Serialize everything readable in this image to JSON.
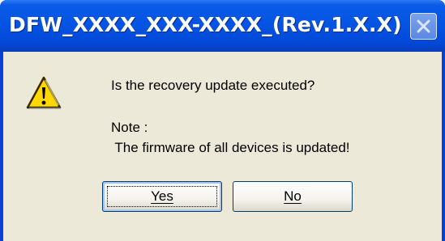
{
  "window": {
    "title": "DFW_XXXX_XXX-XXXX_(Rev.1.X.X)",
    "close_icon": "close-icon"
  },
  "dialog": {
    "icon": "warning-icon",
    "question": "Is the recovery update executed?",
    "note_label": "Note :",
    "note_text": " The firmware of all devices is updated!"
  },
  "buttons": {
    "yes_label": "Yes",
    "no_label": "No"
  },
  "colors": {
    "titlebar": "#0553e2",
    "client": "#ece9d8",
    "title_text": "#ffffff",
    "warning_fill": "#ffd800"
  }
}
